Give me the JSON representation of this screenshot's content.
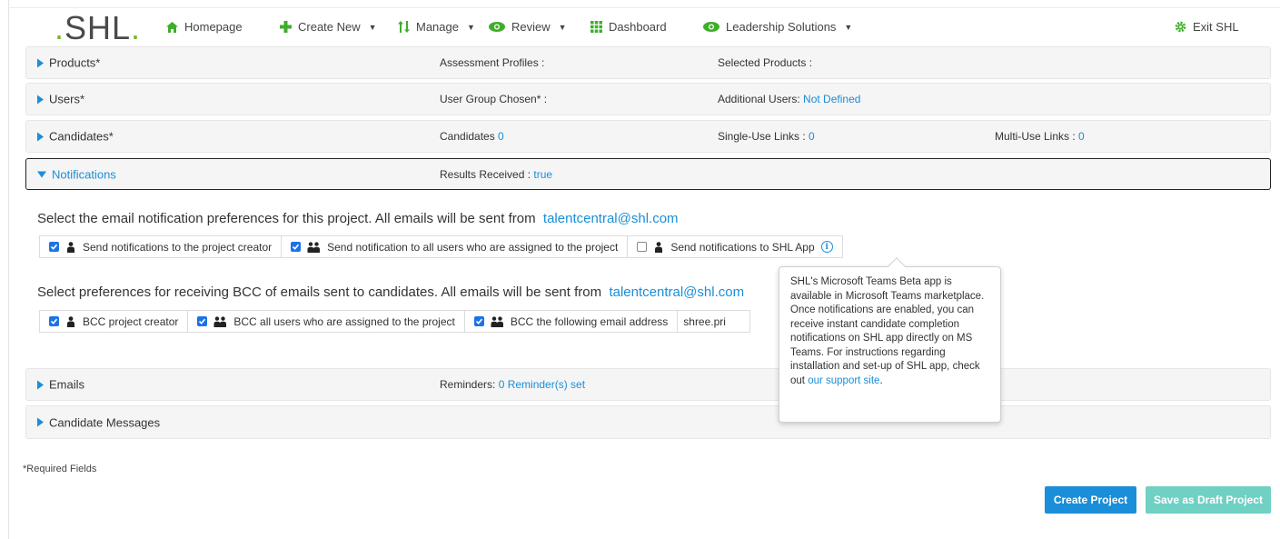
{
  "header": {
    "logo_text": "SHL",
    "logo_dot": ".",
    "nav": [
      {
        "label": "Homepage",
        "icon": "home-icon",
        "has_caret": false
      },
      {
        "label": "Create New",
        "icon": "plus-icon",
        "has_caret": true
      },
      {
        "label": "Manage",
        "icon": "manage-arrows-icon",
        "has_caret": true
      },
      {
        "label": "Review",
        "icon": "eye-icon",
        "has_caret": true
      },
      {
        "label": "Dashboard",
        "icon": "grid-icon",
        "has_caret": false
      },
      {
        "label": "Leadership Solutions",
        "icon": "eye-icon",
        "has_caret": true
      }
    ],
    "exit_label": "Exit SHL",
    "caret": "▼"
  },
  "sections": {
    "products": {
      "title": "Products*",
      "col1_label": "Assessment Profiles :",
      "col2_label": "Selected Products :"
    },
    "users": {
      "title": "Users*",
      "col1_label": "User Group Chosen* :",
      "col2_label": "Additional Users: ",
      "col2_value": "Not Defined"
    },
    "candidates": {
      "title": "Candidates*",
      "col1_label": "Candidates ",
      "col1_value": "0",
      "col2_label": "Single-Use Links : ",
      "col2_value": "0",
      "col3_label": "Multi-Use Links : ",
      "col3_value": "0"
    },
    "notifications": {
      "title": "Notifications",
      "col1_label": "Results Received : ",
      "col1_value": "true"
    },
    "emails": {
      "title": "Emails",
      "col1_label": "Reminders: ",
      "col1_value": "0 Reminder(s) set"
    },
    "candidate_messages": {
      "title": "Candidate Messages"
    }
  },
  "notifications_panel": {
    "email_pref_text": "Select the email notification preferences for this project. All emails will be sent from",
    "sender_email": "talentcentral@shl.com",
    "email_options": [
      {
        "label": "Send notifications to the project creator",
        "checked": true,
        "icon": "single-user-icon"
      },
      {
        "label": "Send notification to all users who are assigned to the project",
        "checked": true,
        "icon": "multi-user-icon"
      },
      {
        "label": "Send notifications to SHL App",
        "checked": false,
        "icon": "single-user-icon"
      }
    ],
    "bcc_pref_text": "Select preferences for receiving BCC of emails sent to candidates. All emails will be sent from",
    "bcc_sender_email": "talentcentral@shl.com",
    "bcc_options": [
      {
        "label": "BCC project creator",
        "checked": true,
        "icon": "single-user-icon"
      },
      {
        "label": "BCC all users who are assigned to the project",
        "checked": true,
        "icon": "multi-user-icon"
      },
      {
        "label": "BCC the following email address",
        "checked": true,
        "icon": "multi-user-icon"
      }
    ],
    "bcc_email_value": "shree.pri"
  },
  "tooltip": {
    "text": "SHL's Microsoft Teams Beta app is available in Microsoft Teams marketplace. Once notifications are enabled, you can receive instant candidate completion notifications on SHL app directly on MS Teams. For instructions regarding installation and set-up of SHL app, check out ",
    "link_text": "our support site",
    "suffix": "."
  },
  "footer": {
    "required_note": "*Required Fields",
    "create_button": "Create Project",
    "draft_button": "Save as Draft Project"
  },
  "colors": {
    "accent_blue": "#1a8ed8",
    "logo_green": "#79b52a",
    "draft_button": "#6fd0c4",
    "nav_icon_green": "#3fae2a"
  }
}
